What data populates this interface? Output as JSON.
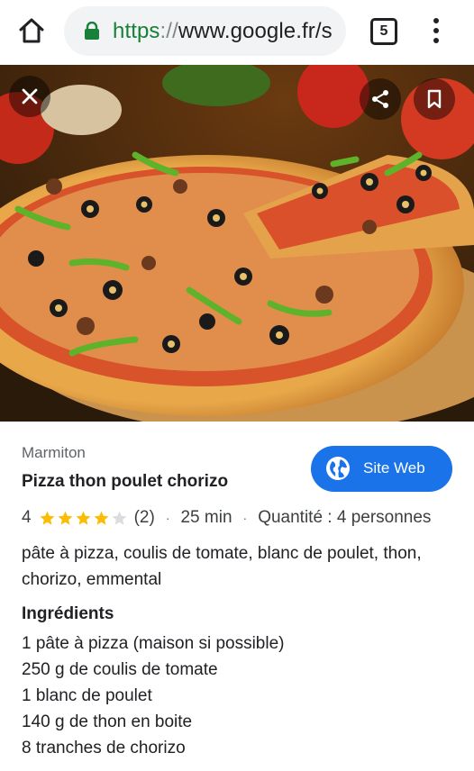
{
  "browser": {
    "url_scheme": "https",
    "url_sep": "://",
    "url_host": "www.google.fr/s",
    "tab_count": "5"
  },
  "recipe": {
    "source": "Marmiton",
    "title": "Pizza thon poulet chorizo",
    "site_button": "Site Web",
    "rating_value": "4",
    "rating_stars": 4,
    "rating_max": 5,
    "rating_count": "(2)",
    "duration": "25 min",
    "quantity": "Quantité : 4 personnes",
    "description": "pâte à pizza, coulis de tomate, blanc de poulet, thon, chorizo, emmental",
    "ingredients_title": "Ingrédients",
    "ingredients": [
      "1 pâte à pizza (maison si possible)",
      "250 g de coulis de tomate",
      "1 blanc de poulet",
      "140 g de thon en boite",
      "8 tranches de chorizo"
    ]
  },
  "colors": {
    "accent": "#1a73e8",
    "lock_green": "#188038",
    "star": "#fbbc04",
    "star_empty": "#dadce0"
  }
}
